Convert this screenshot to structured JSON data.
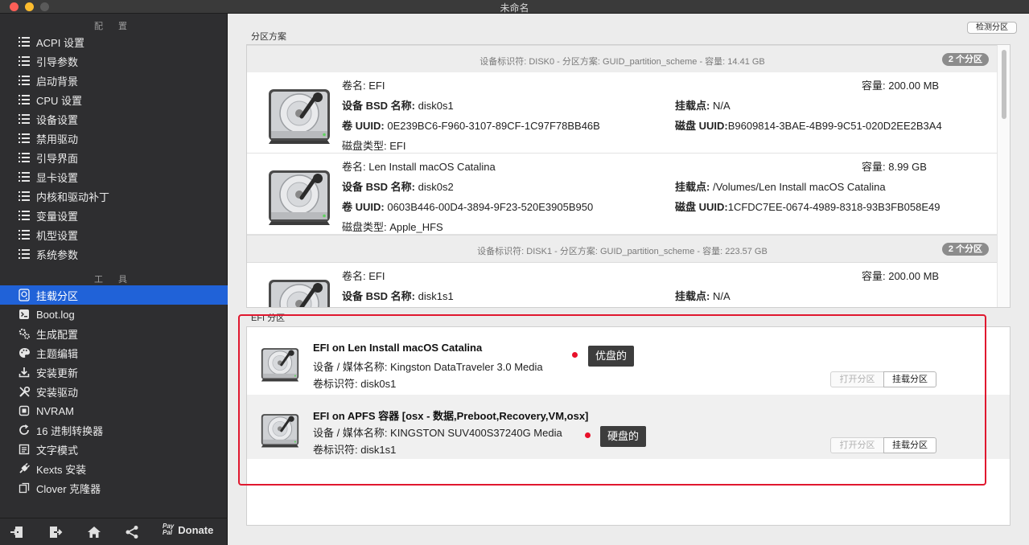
{
  "window": {
    "title": "未命名"
  },
  "sidebar": {
    "config_header": "配 置",
    "config_items": [
      {
        "label": "ACPI 设置",
        "icon": "list-icon"
      },
      {
        "label": "引导参数",
        "icon": "list-icon"
      },
      {
        "label": "启动背景",
        "icon": "list-icon"
      },
      {
        "label": "CPU 设置",
        "icon": "list-icon"
      },
      {
        "label": "设备设置",
        "icon": "list-icon"
      },
      {
        "label": "禁用驱动",
        "icon": "list-icon"
      },
      {
        "label": "引导界面",
        "icon": "list-icon"
      },
      {
        "label": "显卡设置",
        "icon": "list-icon"
      },
      {
        "label": "内核和驱动补丁",
        "icon": "list-icon"
      },
      {
        "label": "变量设置",
        "icon": "list-icon"
      },
      {
        "label": "机型设置",
        "icon": "list-icon"
      },
      {
        "label": "系统参数",
        "icon": "list-icon"
      }
    ],
    "tools_header": "工 具",
    "tool_items": [
      {
        "label": "挂载分区",
        "icon": "disk-icon",
        "active": true
      },
      {
        "label": "Boot.log",
        "icon": "terminal-icon"
      },
      {
        "label": "生成配置",
        "icon": "gears-icon"
      },
      {
        "label": "主题编辑",
        "icon": "palette-icon"
      },
      {
        "label": "安装更新",
        "icon": "download-icon"
      },
      {
        "label": "安装驱动",
        "icon": "wrench-icon"
      },
      {
        "label": "NVRAM",
        "icon": "chip-icon"
      },
      {
        "label": "16 进制转换器",
        "icon": "refresh-icon"
      },
      {
        "label": "文字模式",
        "icon": "text-icon"
      },
      {
        "label": "Kexts 安装",
        "icon": "plug-icon"
      },
      {
        "label": "Clover 克隆器",
        "icon": "copy-icon"
      }
    ],
    "footer": {
      "paypal_line1": "Pay",
      "paypal_line2": "Pal",
      "donate_label": "Donate"
    }
  },
  "main": {
    "detect_button": "检测分区",
    "partition_scheme_label": "分区方案",
    "disks": [
      {
        "header": "设备标识符: DISK0 - 分区方案: GUID_partition_scheme - 容量: 14.41 GB",
        "badge": "2 个分区",
        "volumes": [
          {
            "name": "卷名: EFI",
            "capacity": "容量:  200.00 MB",
            "bsd_key": "设备 BSD 名称: ",
            "bsd_val": "disk0s1",
            "mount_key": "挂载点: ",
            "mount_val": "N/A",
            "uuid_key": "卷 UUID: ",
            "uuid_val": "0E239BC6-F960-3107-89CF-1C97F78BB46B",
            "disk_uuid_key": "磁盘 UUID:",
            "disk_uuid_val": "B9609814-3BAE-4B99-9C51-020D2EE2B3A4",
            "type": "磁盘类型: EFI"
          },
          {
            "name": "卷名: Len Install macOS Catalina",
            "capacity": "容量:    8.99 GB",
            "bsd_key": "设备 BSD 名称: ",
            "bsd_val": "disk0s2",
            "mount_key": "挂载点: ",
            "mount_val": "/Volumes/Len Install macOS Catalina",
            "uuid_key": "卷 UUID: ",
            "uuid_val": "0603B446-00D4-3894-9F23-520E3905B950",
            "disk_uuid_key": "磁盘 UUID:",
            "disk_uuid_val": "1CFDC7EE-0674-4989-8318-93B3FB058E49",
            "type": "磁盘类型: Apple_HFS"
          }
        ]
      },
      {
        "header": "设备标识符: DISK1 - 分区方案: GUID_partition_scheme - 容量: 223.57 GB",
        "badge": "2 个分区",
        "volumes": [
          {
            "name": "卷名: EFI",
            "capacity": "容量:  200.00 MB",
            "bsd_key": "设备 BSD 名称: ",
            "bsd_val": "disk1s1",
            "mount_key": "挂载点: ",
            "mount_val": "N/A"
          }
        ]
      }
    ],
    "efi_label": "EFI 分区",
    "efi_rows": [
      {
        "title": "EFI on Len Install macOS Catalina",
        "media": "设备 / 媒体名称: Kingston DataTraveler 3.0 Media",
        "identifier": "卷标识符: disk0s1",
        "open_button": "打开分区",
        "mount_button": "挂载分区",
        "annotation": "优盘的"
      },
      {
        "title": "EFI on APFS 容器 [osx - 数据,Preboot,Recovery,VM,osx]",
        "media": "设备 / 媒体名称: KINGSTON SUV400S37240G Media",
        "identifier": "卷标识符: disk1s1",
        "open_button": "打开分区",
        "mount_button": "挂载分区",
        "annotation": "硬盘的"
      }
    ]
  },
  "colors": {
    "sidebar_bg": "#2e2e30",
    "active_bg": "#2062d8",
    "annotation_red": "#e0182f"
  }
}
